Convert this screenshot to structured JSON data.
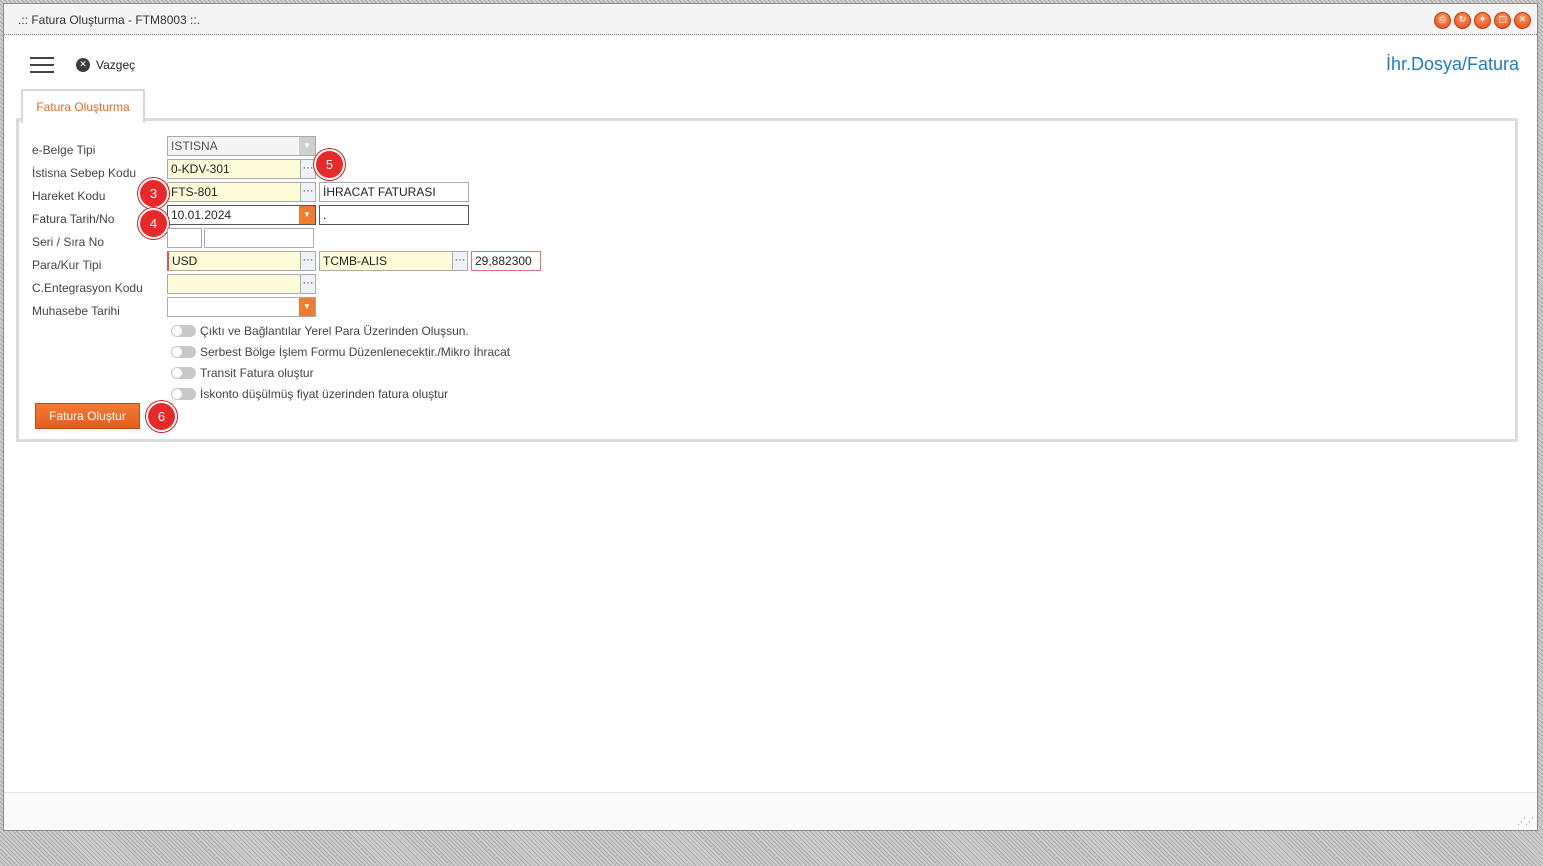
{
  "window": {
    "title": ".:: Fatura Oluşturma - FTM8003 ::."
  },
  "toolbar": {
    "vazgec_label": "Vazgeç",
    "brand_link": "İhr.Dosya/Fatura"
  },
  "tab": {
    "label": "Fatura Oluşturma"
  },
  "form": {
    "ebelge_tipi": {
      "label": "e-Belge Tipi",
      "value": "ISTISNA"
    },
    "istisna_sebep": {
      "label": "İstisna Sebep Kodu",
      "value": "0-KDV-301"
    },
    "hareket_kodu": {
      "label": "Hareket Kodu",
      "value": "FTS-801",
      "desc": "İHRACAT FATURASI"
    },
    "fatura_tarih": {
      "label": "Fatura Tarih/No",
      "date": "10.01.2024",
      "no": "."
    },
    "seri_sira": {
      "label": "Seri / Sıra No",
      "seri": "",
      "sira": ""
    },
    "para_kur": {
      "label": "Para/Kur Tipi",
      "para": "USD",
      "kur_tipi": "TCMB-ALIS",
      "kur": "29,882300"
    },
    "entegrasyon": {
      "label": "C.Entegrasyon Kodu",
      "value": ""
    },
    "muhasebe_tarihi": {
      "label": "Muhasebe Tarihi",
      "value": ""
    },
    "toggles": [
      {
        "label": "Çıktı ve Bağlantılar Yerel Para Üzerinden Oluşsun.",
        "on": false
      },
      {
        "label": "Serbest Bölge İşlem Formu Düzenlenecektir./Mikro İhracat",
        "on": false
      },
      {
        "label": "Transit Fatura oluştur",
        "on": false
      },
      {
        "label": "İskonto düşülmüş fiyat üzerinden fatura oluştur",
        "on": false
      }
    ],
    "submit_label": "Fatura Oluştur"
  },
  "badges": {
    "b3": "3",
    "b4": "4",
    "b5": "5",
    "b6": "6"
  },
  "icons": {
    "dots": "···",
    "dropdown": "▼",
    "close": "✕"
  },
  "colors": {
    "accent": "#f07b2e",
    "link": "#1f7ac4",
    "badge": "#e62a2a",
    "required_bg": "#fefbd9"
  }
}
